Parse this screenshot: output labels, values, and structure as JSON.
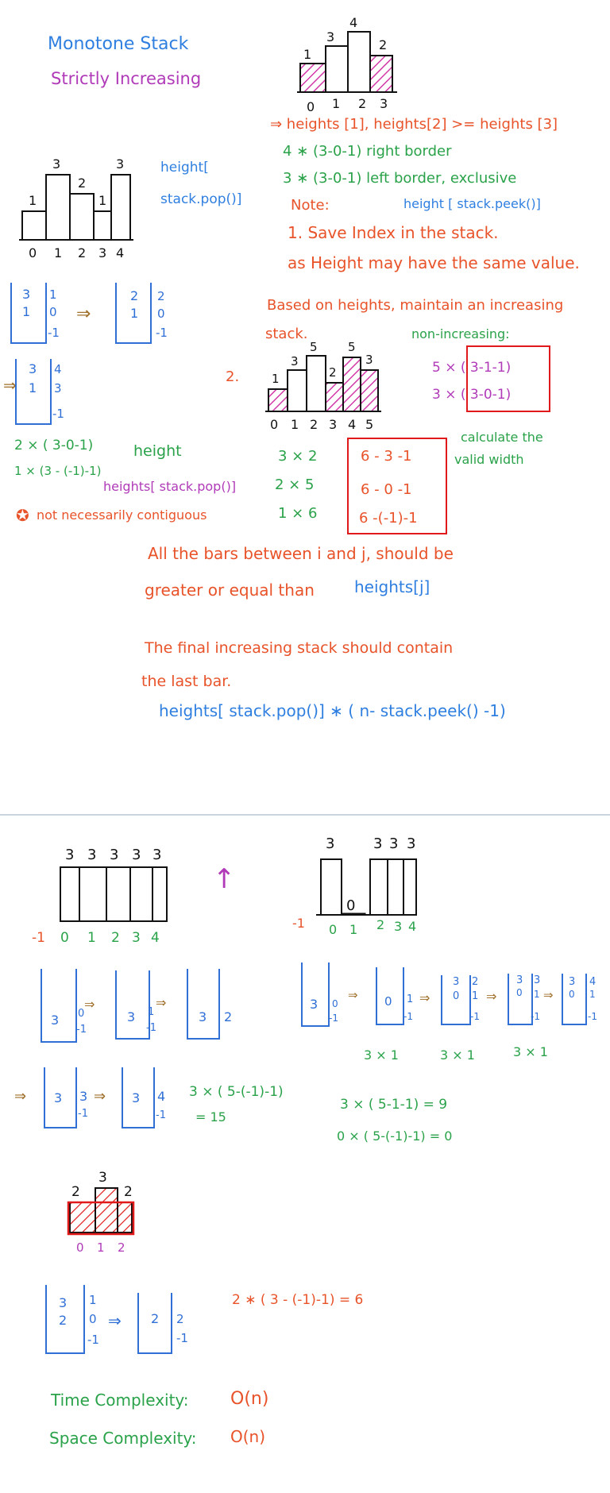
{
  "colors": {
    "blue": "#2f7fe0",
    "purple": "#b03ab8",
    "red": "#e8532a",
    "green": "#2aa24a",
    "black": "#111111",
    "brown": "#a0702a",
    "stackblue": "#2f6fd6",
    "magenta": "#d23aa8",
    "divider": "#b7c7d4",
    "boxred": "#e01a1a"
  },
  "header": {
    "title": "Monotone Stack",
    "subtitle": "Strictly Increasing"
  },
  "top_chart": {
    "values": [
      "1",
      "3",
      "4",
      "2"
    ],
    "indices": [
      "0",
      "1",
      "2",
      "3"
    ]
  },
  "notes_top": {
    "line1": "⇒ heights [1], heights[2] >= heights [3]",
    "line2": "4 ∗ (3-0-1) right border",
    "line3": "3 ∗ (3-0-1) left border, exclusive",
    "note_label": "Note:",
    "note_code": "height [ stack.peek()]",
    "item1_line1": "1. Save Index in the stack.",
    "item1_line2": "as Height may have the same value."
  },
  "left_chart": {
    "values": [
      "1",
      "3",
      "2",
      "1",
      "3"
    ],
    "indices": [
      "0",
      "1",
      "2",
      "3",
      "4"
    ],
    "code_line1": "height[",
    "code_line2": "stack.pop()]"
  },
  "stack_section1": {
    "s1": [
      "3",
      "1"
    ],
    "s1_idx": [
      "1",
      "0",
      "-1"
    ],
    "s2": [
      "2",
      "1"
    ],
    "s2_idx": [
      "2",
      "0",
      "-1"
    ],
    "s3": [
      "3",
      "1"
    ],
    "s3_idx": [
      "4",
      "3",
      "-1"
    ],
    "calc1": "2 × ( 3-0-1)",
    "height_label": "height",
    "calc2": "1 × (3 - (-1)-1)",
    "pop_label": "heights[ stack.pop()]",
    "contiguous_note": "not necessarily contiguous"
  },
  "section2": {
    "based_line1": "Based on heights, maintain an increasing",
    "based_line2": "stack.",
    "non_increasing": "non-increasing:",
    "calc_a": "5 × ( 3-1-1)",
    "calc_b": "3 × ( 3-0-1)",
    "num2": "2.",
    "chart_values": [
      "1",
      "3",
      "5",
      "2",
      "5",
      "3"
    ],
    "chart_indices": [
      "0",
      "1",
      "2",
      "3",
      "4",
      "5"
    ],
    "prod1": "3 × 2",
    "prod2": "2 × 5",
    "prod3": "1 × 6",
    "box1": "6 - 3 -1",
    "box2": "6 - 0 -1",
    "box3": "6 -(-1)-1",
    "valid_line1": "calculate the",
    "valid_line2": "valid width",
    "all_bars_line1": "All the bars between i and j, should be",
    "all_bars_line2": "greater or equal than",
    "heights_j": "heights[j]",
    "final_line1": "The final increasing stack should contain",
    "final_line2": "the last bar.",
    "formula": "heights[ stack.pop()] ∗ ( n- stack.peek() -1)"
  },
  "bottom_left": {
    "values": [
      "3",
      "3",
      "3",
      "3",
      "3"
    ],
    "indices": [
      "-1",
      "0",
      "1",
      "2",
      "3",
      "4"
    ],
    "arrow": "↑",
    "stk1": [
      "3",
      "0",
      "-1"
    ],
    "stk2": [
      "3",
      "1",
      "-1"
    ],
    "stk3": [
      "3",
      "2"
    ],
    "stk4": [
      "3",
      "3",
      "-1"
    ],
    "stk5": [
      "3",
      "4",
      "-1"
    ],
    "calc": "3 × ( 5-(-1)-1)",
    "result": "= 15"
  },
  "bottom_right": {
    "values": [
      "3",
      "0",
      "3",
      "3",
      "3"
    ],
    "indices": [
      "-1",
      "0",
      "1",
      "2",
      "3",
      "4"
    ],
    "stk1": [
      "3",
      "0",
      "-1"
    ],
    "stk2": [
      "0",
      "1",
      "-1"
    ],
    "stk3": [
      "3",
      "0",
      "2",
      "1",
      "-1"
    ],
    "stk4": [
      "3",
      "0",
      "3",
      "1",
      "-1"
    ],
    "stk5": [
      "3",
      "0",
      "4",
      "1",
      "-1"
    ],
    "m1": "3 × 1",
    "m2": "3 × 1",
    "m3": "3 × 1",
    "calc1": "3 × ( 5-1-1) = 9",
    "calc2": "0 × ( 5-(-1)-1) = 0"
  },
  "bottom_small": {
    "values": [
      "2",
      "3",
      "2"
    ],
    "indices": [
      "0",
      "1",
      "2"
    ],
    "stk1": [
      "3",
      "2"
    ],
    "stk1_idx": [
      "1",
      "0",
      "-1"
    ],
    "stk2": [
      "2"
    ],
    "stk2_idx": [
      "2",
      "-1"
    ],
    "calc": "2 ∗ ( 3 - (-1)-1) = 6"
  },
  "complexity": {
    "time_label": "Time Complexity:",
    "time_value": "O(n)",
    "space_label": "Space Complexity:",
    "space_value": "O(n)"
  }
}
